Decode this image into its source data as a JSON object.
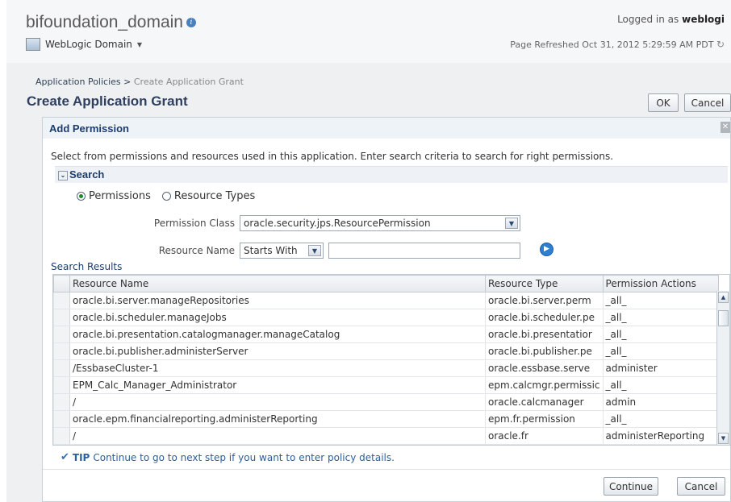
{
  "header": {
    "domain_title": "bifoundation_domain",
    "menu_label": "WebLogic Domain",
    "logged_prefix": "Logged in as",
    "logged_user": "weblogi",
    "refreshed": "Page Refreshed Oct 31, 2012 5:29:59 AM PDT"
  },
  "breadcrumb": {
    "parent": "Application Policies",
    "separator": " > ",
    "current": "Create Application Grant"
  },
  "page": {
    "title": "Create Application Grant",
    "ok_label": "OK",
    "cancel_label": "Cancel"
  },
  "dialog": {
    "title": "Add Permission",
    "description": "Select from permissions and resources used in this application. Enter search criteria to search for right permissions.",
    "search": {
      "label": "Search",
      "radio_permissions": "Permissions",
      "radio_resource_types": "Resource Types",
      "selected_radio": "Permissions",
      "permission_class_label": "Permission Class",
      "permission_class_value": "oracle.security.jps.ResourcePermission",
      "resource_name_label": "Resource Name",
      "resource_name_operator": "Starts With",
      "resource_name_value": ""
    },
    "results": {
      "label": "Search Results",
      "columns": [
        "Resource Name",
        "Resource Type",
        "Permission Actions"
      ],
      "rows": [
        {
          "name": "oracle.bi.server.manageRepositories",
          "type": "oracle.bi.server.perm",
          "actions": "_all_"
        },
        {
          "name": "oracle.bi.scheduler.manageJobs",
          "type": "oracle.bi.scheduler.pe",
          "actions": "_all_"
        },
        {
          "name": "oracle.bi.presentation.catalogmanager.manageCatalog",
          "type": "oracle.bi.presentatior",
          "actions": "_all_"
        },
        {
          "name": "oracle.bi.publisher.administerServer",
          "type": "oracle.bi.publisher.pe",
          "actions": "_all_"
        },
        {
          "name": "/EssbaseCluster-1",
          "type": "oracle.essbase.serve",
          "actions": "administer"
        },
        {
          "name": "EPM_Calc_Manager_Administrator",
          "type": "epm.calcmgr.permissic",
          "actions": "_all_"
        },
        {
          "name": "/",
          "type": "oracle.calcmanager",
          "actions": "admin"
        },
        {
          "name": "oracle.epm.financialreporting.administerReporting",
          "type": "epm.fr.permission",
          "actions": "_all_"
        },
        {
          "name": "/",
          "type": "oracle.fr",
          "actions": "administerReporting"
        }
      ]
    },
    "tip_label": "TIP",
    "tip_text": "Continue to go to next step if you want to enter policy details.",
    "continue_label": "Continue",
    "cancel_label": "Cancel"
  },
  "colors": {
    "accent": "#1c3c6c",
    "link": "#2b5f9e",
    "radio_on": "#1a8a2a"
  }
}
